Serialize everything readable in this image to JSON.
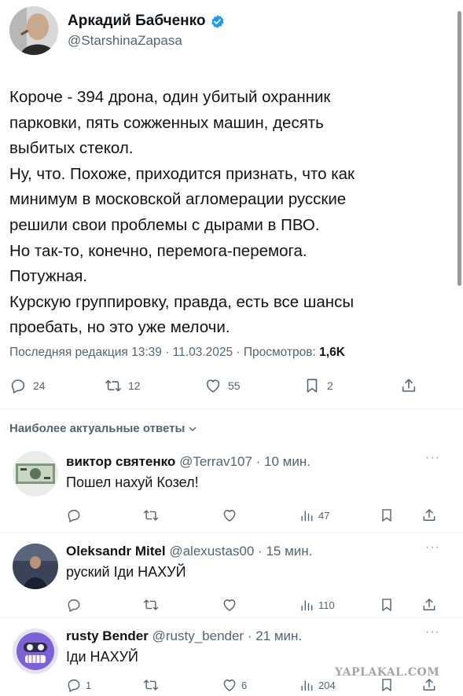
{
  "author": {
    "name": "Аркадий Бабченко",
    "handle": "@StarshinaZapasa",
    "verified_color": "#1d9bf0"
  },
  "tweet": {
    "lines": [
      "Короче - 394 дрона, один убитый охранник",
      "парковки, пять сожженных машин, десять",
      "выбитых стекол.",
      "Ну, что. Похоже, приходится признать, что как",
      "минимум в московской агломерации русские",
      "решили свои проблемы с дырами в ПВО.",
      "Но так-то, конечно, перемога-перемога.",
      "Потужная.",
      "Курскую группировку, правда, есть все шансы",
      "проебать, но это уже мелочи."
    ],
    "meta": "Последняя редакция 13:39 · 11.03.2025 · Просмотров: ",
    "views": "1,6K",
    "actions": {
      "replies": "24",
      "retweets": "12",
      "likes": "55",
      "bookmarks": "2"
    }
  },
  "replies_header": "Наиболее актуальные ответы",
  "replies": [
    {
      "name": "виктор святенко",
      "handle": "@Terrav107",
      "time": " · 10 мин.",
      "text": "Пошел нахуй Козел!",
      "more": "···",
      "views": "47"
    },
    {
      "name": "Oleksandr Mitel",
      "handle": "@alexustas00",
      "time": " · 15 мин.",
      "text": "руский Іди НАХУЙ",
      "more": "···",
      "views": "110"
    },
    {
      "name": "rusty Bender",
      "handle": "@rusty_bender",
      "time": " · 21 мин.",
      "text": "Іди НАХУЙ",
      "more": "···",
      "replies": "1",
      "likes": "6",
      "views": "204"
    }
  ],
  "watermark": "YAPLAKAL.COM"
}
